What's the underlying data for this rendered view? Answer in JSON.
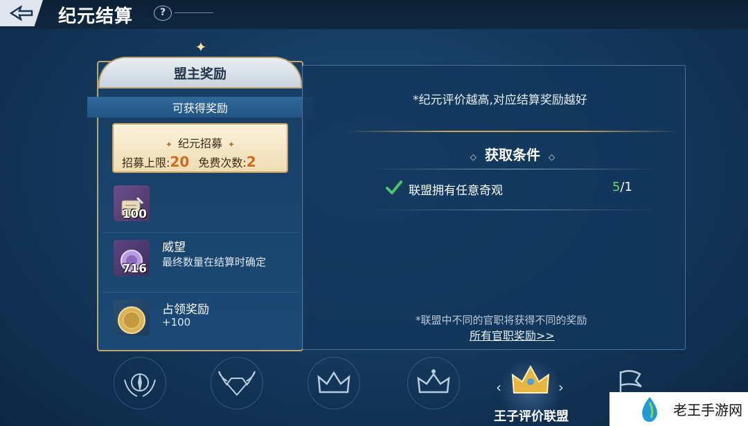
{
  "header": {
    "title": "纪元结算",
    "help": "?"
  },
  "left_panel": {
    "title": "盟主奖励",
    "banner": "可获得奖励",
    "recruit": {
      "title": "纪元招募",
      "limit_label": "招募上限:",
      "limit_value": "20",
      "free_label": "免费次数:",
      "free_value": "2"
    },
    "rewards": [
      {
        "icon": "scroll-icon",
        "count": "100"
      },
      {
        "icon": "prestige-medal-icon",
        "count": "716",
        "name": "威望",
        "desc": "最终数量在结算时确定"
      },
      {
        "icon": "gold-coin-icon",
        "name": "占领奖励",
        "desc": "+100"
      }
    ]
  },
  "right_panel": {
    "rating_note": "*纪元评价越高,对应结算奖励越好",
    "conditions_title": "获取条件",
    "condition": {
      "text": "联盟拥有任意奇观",
      "current": "5",
      "total": "/1"
    },
    "office_note": "*联盟中不同的官职将获得不同的奖励",
    "office_link": "所有官职奖励>>"
  },
  "tabs": {
    "items": [
      "compass-emblem-icon",
      "winged-diamond-icon",
      "crown-icon",
      "crown-icon",
      "golden-crown-icon",
      "flag-icon"
    ],
    "active_label": "王子评价联盟",
    "prev": "‹",
    "next": "›"
  },
  "watermark": {
    "text": "老王手游网"
  },
  "colors": {
    "accent_gold": "#c9a35e",
    "highlight_orange": "#d2691e",
    "progress_green": "#6fd36a"
  }
}
